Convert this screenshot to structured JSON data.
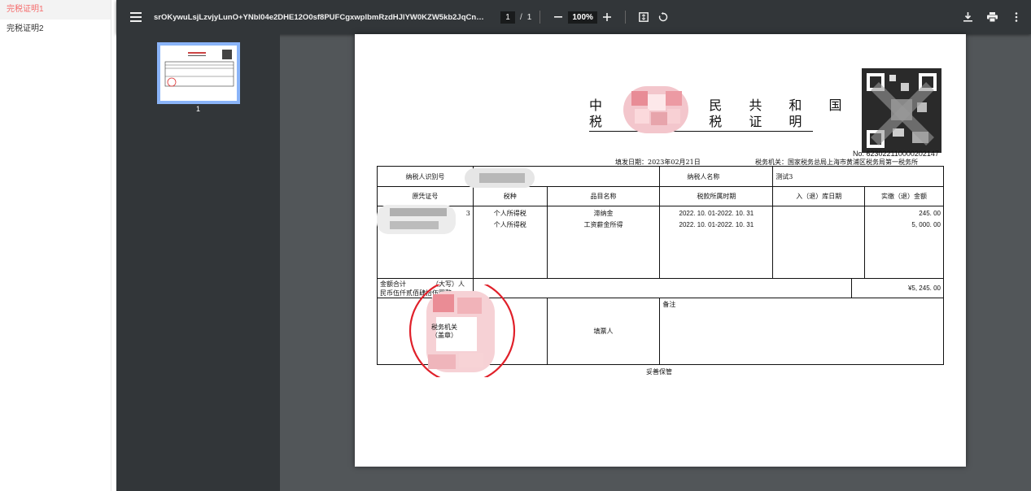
{
  "left_panel": {
    "items": [
      {
        "label": "完税证明1",
        "active": true
      },
      {
        "label": "完税证明2",
        "active": false
      }
    ]
  },
  "toolbar": {
    "title": "srOKywuLsjLzvjyLunO+YNbl04e2DHE12O0sf8PUFCgxwplbmRzdHJlYW0KZW5kb2JqCnhyZWYK...",
    "page_current": "1",
    "page_separator": "/",
    "page_total": "1",
    "zoom": "100%"
  },
  "sidebar": {
    "thumbnail_number": "1"
  },
  "document": {
    "title_line1": "中 华 人 民 共 和 国",
    "title_line2": "税 收 完 税 证 明",
    "number": "No. 623022110000202147",
    "fill_date_label": "填发日期：",
    "fill_date": "2023年02月21日",
    "tax_authority_label": "税务机关：",
    "tax_authority": "国家税务总局上海市黄浦区税务局第一税务所",
    "taxpayer_id_label": "纳税人识别号",
    "taxpayer_name_label": "纳税人名称",
    "taxpayer_name": "测试3",
    "headers": [
      "原凭证号",
      "税种",
      "品目名称",
      "税款所属时期",
      "入（退）库日期",
      "实缴（退）金额"
    ],
    "rows": [
      {
        "cert_no": "",
        "tax_type": "个人所得税",
        "item": "滞纳金",
        "period": "2022. 10. 01-2022. 10. 31",
        "date": "",
        "amount": "245. 00"
      },
      {
        "cert_no": "3",
        "tax_type": "个人所得税",
        "item": "工资薪金所得",
        "period": "2022. 10. 01-2022. 10. 31",
        "date": "",
        "amount": "5, 000. 00"
      }
    ],
    "total_label": "金额合计",
    "total_words": "（大写）人民币伍仟贰佰肆拾伍圆整",
    "total_amount": "¥5, 245. 00",
    "stamp_line1": "税务机关",
    "stamp_line2": "（盖章）",
    "filler_label": "填票人",
    "remark_label": "备注",
    "footer": "妥善保管"
  },
  "colors": {
    "toolbar_bg": "#323639",
    "viewer_bg": "#525659",
    "active_item": "#f56c6c",
    "stamp_red": "#e0202a",
    "thumbnail_border": "#8ab4f8"
  }
}
